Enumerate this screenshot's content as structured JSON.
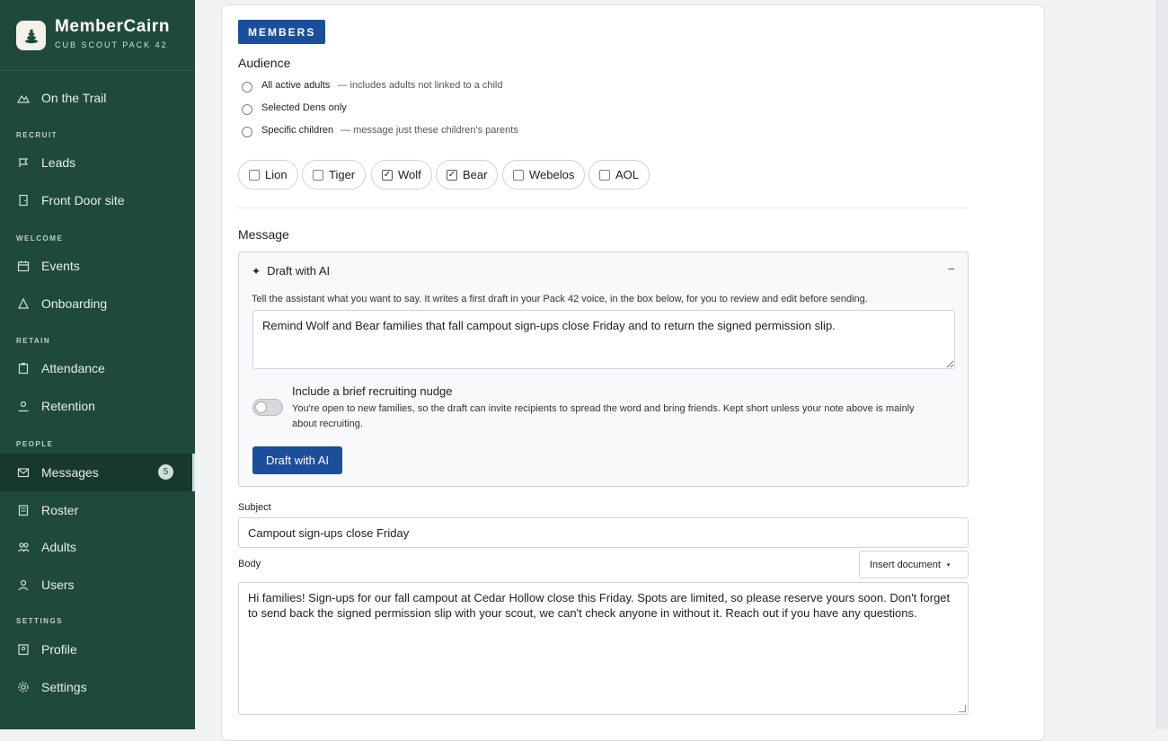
{
  "app": {
    "name": "MemberCairn",
    "subtitle": "CUB SCOUT PACK 42"
  },
  "sidebar": {
    "top_item": {
      "label": "On the Trail",
      "icon": "trail-icon"
    },
    "sections": [
      {
        "title": "RECRUIT",
        "items": [
          {
            "label": "Leads",
            "icon": "leads-icon"
          },
          {
            "label": "Front Door site",
            "icon": "door-icon"
          }
        ]
      },
      {
        "title": "WELCOME",
        "items": [
          {
            "label": "Events",
            "icon": "calendar-icon"
          },
          {
            "label": "Onboarding",
            "icon": "onboarding-icon"
          }
        ]
      },
      {
        "title": "RETAIN",
        "items": [
          {
            "label": "Attendance",
            "icon": "clipboard-icon"
          },
          {
            "label": "Retention",
            "icon": "retention-icon"
          }
        ]
      },
      {
        "title": "PEOPLE",
        "items": [
          {
            "label": "Messages",
            "icon": "mail-icon",
            "badge": "5",
            "active": true
          },
          {
            "label": "Roster",
            "icon": "roster-icon"
          },
          {
            "label": "Adults",
            "icon": "adults-icon"
          },
          {
            "label": "Users",
            "icon": "users-icon"
          }
        ]
      },
      {
        "title": "SETTINGS",
        "items": [
          {
            "label": "Profile",
            "icon": "profile-icon"
          },
          {
            "label": "Settings",
            "icon": "settings-icon"
          }
        ]
      }
    ]
  },
  "compose": {
    "tab_label": "MEMBERS",
    "audience_label": "Audience",
    "audience_options": [
      {
        "label": "All active adults",
        "note": "— includes adults not linked to a child",
        "selected": false
      },
      {
        "label": "Selected Dens only",
        "note": "",
        "selected": false
      },
      {
        "label": "Specific children",
        "note": "— message just these children's parents",
        "selected": false
      }
    ],
    "dens": [
      {
        "label": "Lion",
        "checked": false
      },
      {
        "label": "Tiger",
        "checked": false
      },
      {
        "label": "Wolf",
        "checked": true
      },
      {
        "label": "Bear",
        "checked": true
      },
      {
        "label": "Webelos",
        "checked": false
      },
      {
        "label": "AOL",
        "checked": false
      }
    ],
    "message_label": "Message",
    "ai": {
      "title": "Draft with AI",
      "collapse": "−",
      "help": "Tell the assistant what you want to say. It writes a first draft in your Pack 42 voice, in the box below, for you to review and edit before sending.",
      "prompt": "Remind Wolf and Bear families that fall campout sign-ups close Friday and to return the signed permission slip.",
      "nudge_title": "Include a brief recruiting nudge",
      "nudge_desc": "You're open to new families, so the draft can invite recipients to spread the word and bring friends. Kept short unless your note above is mainly about recruiting.",
      "nudge_on": false,
      "button": "Draft with AI"
    },
    "subject_label": "Subject",
    "subject_value": "Campout sign-ups close Friday",
    "body_label": "Body",
    "insert_document": "Insert document",
    "body_value": "Hi families! Sign-ups for our fall campout at Cedar Hollow close this Friday. Spots are limited, so please reserve yours soon. Don't forget to send back the signed permission slip with your scout, we can't check anyone in without it. Reach out if you have any questions."
  },
  "colors": {
    "sidebar_bg": "#1f4a3b",
    "accent": "#1b4f9c"
  }
}
